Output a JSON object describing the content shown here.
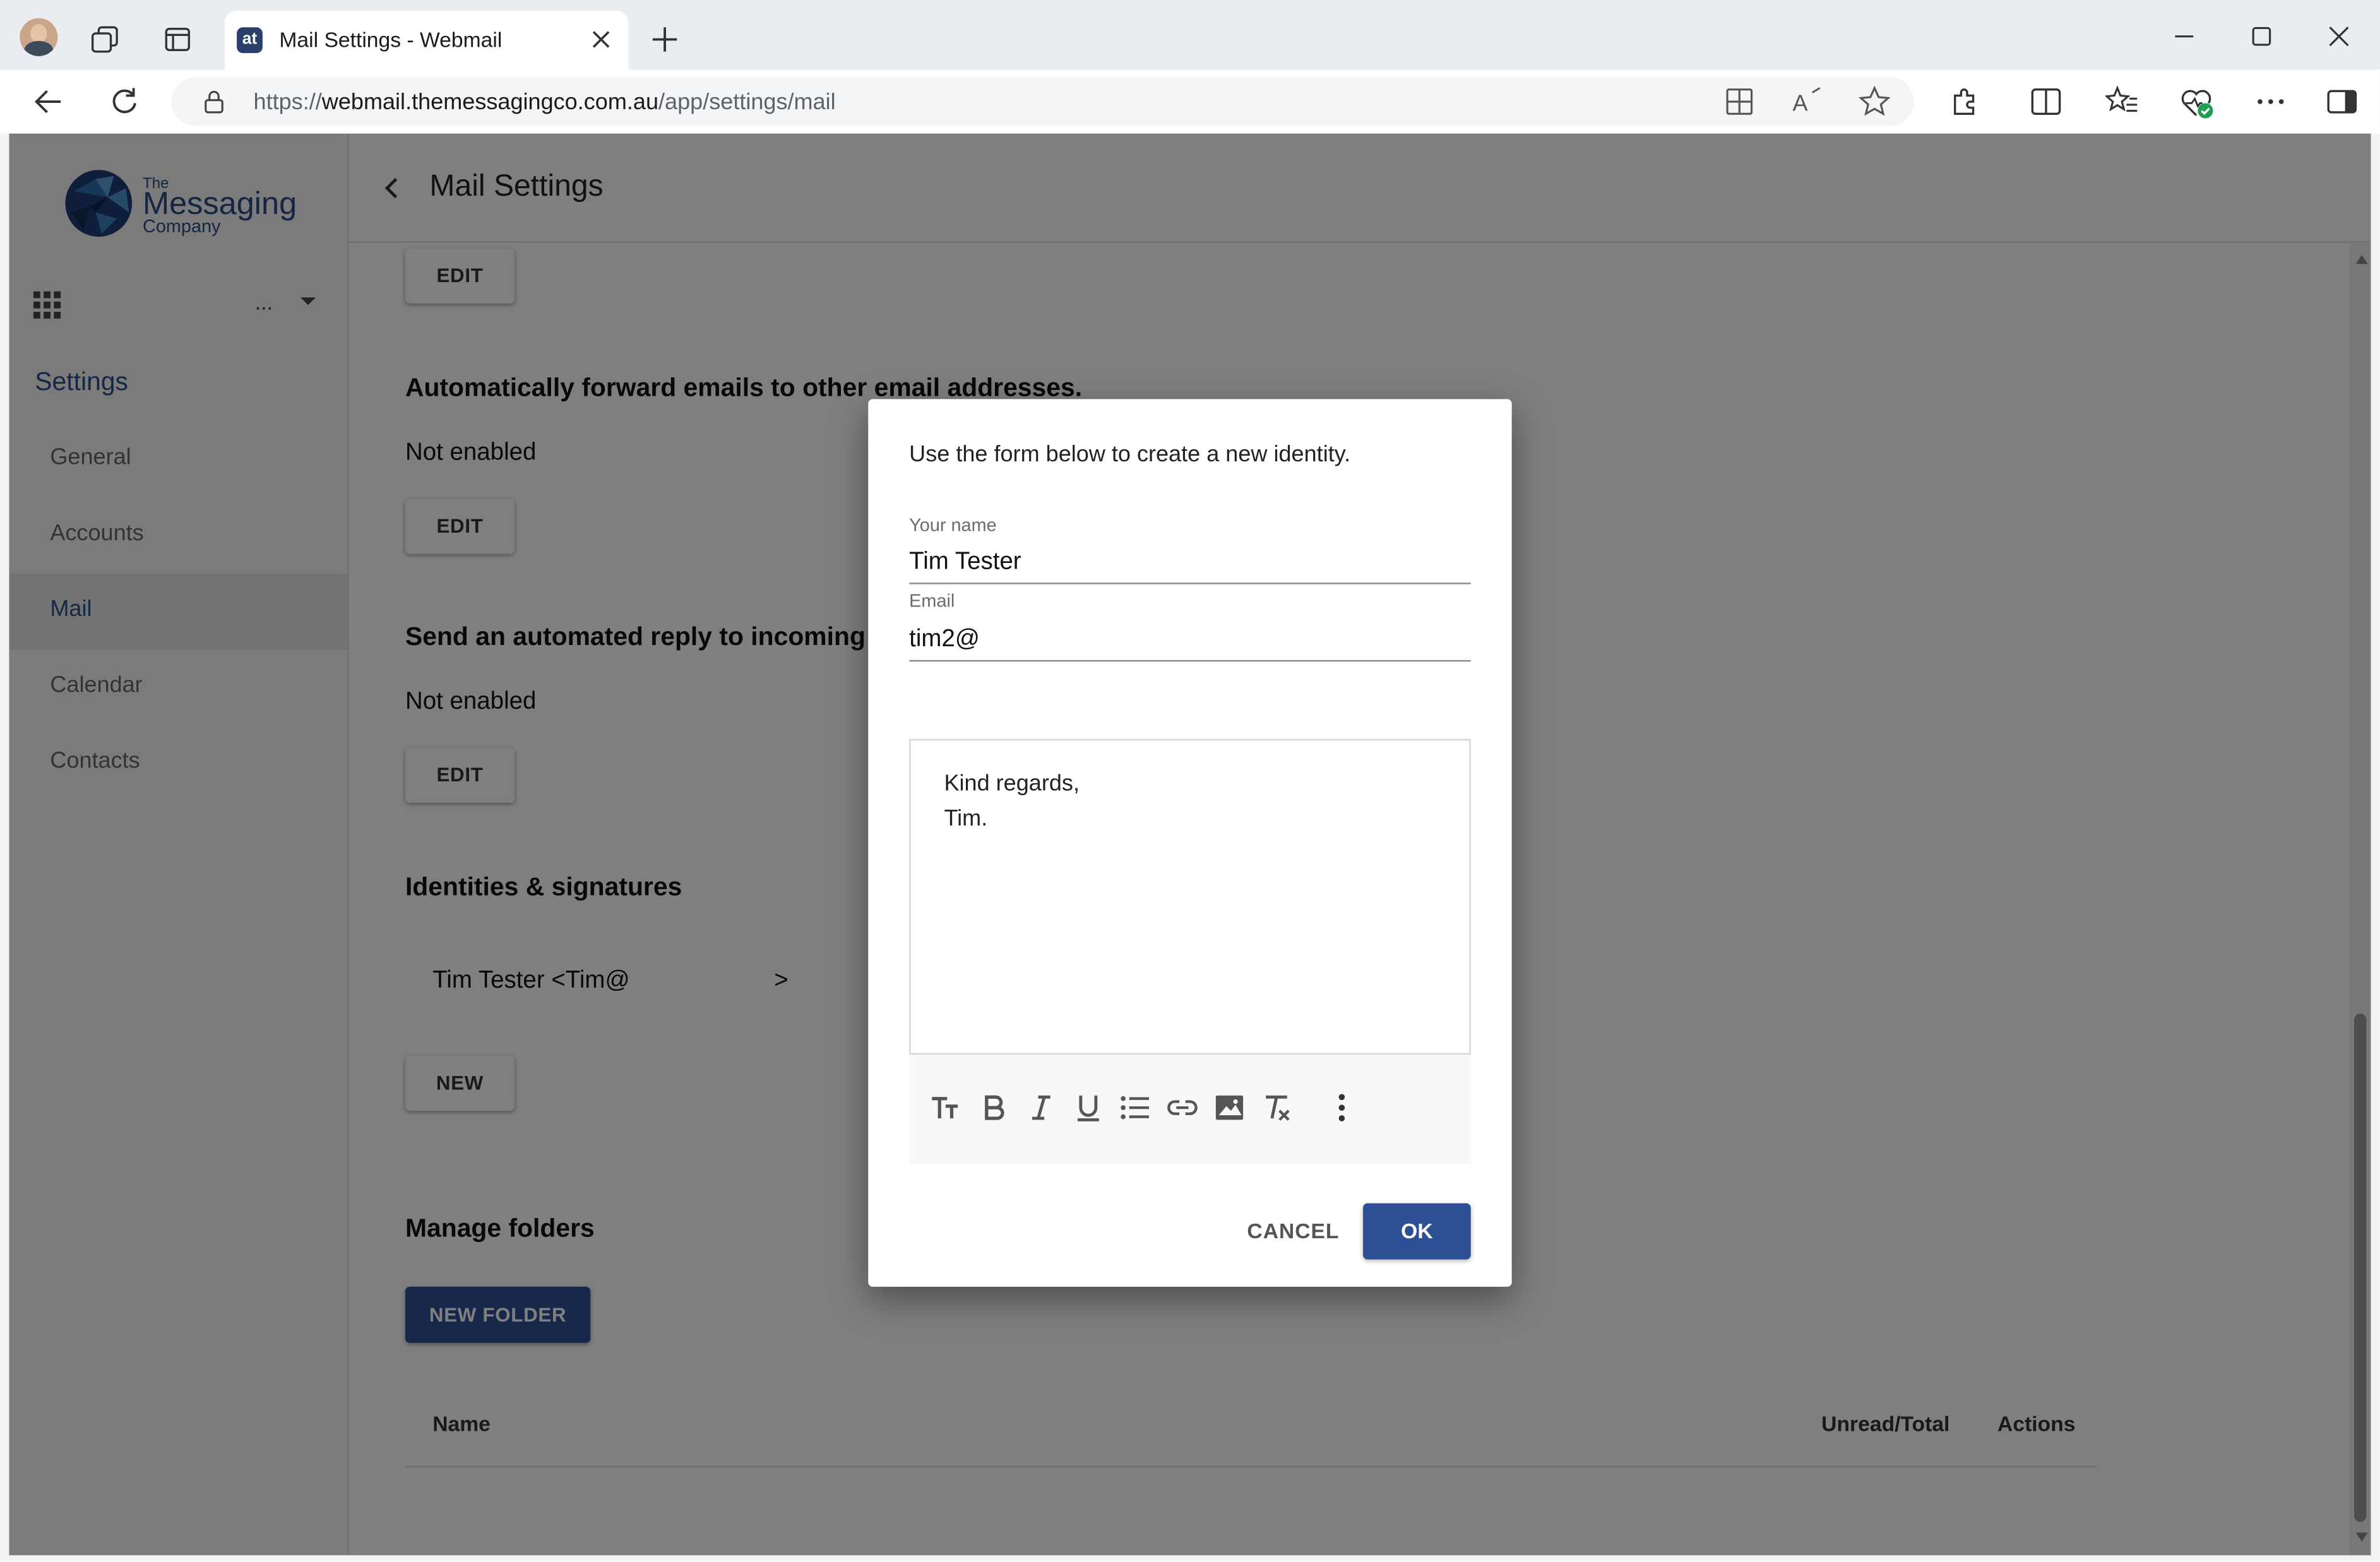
{
  "browser": {
    "tab_title": "Mail Settings - Webmail",
    "tab_favicon": "at",
    "url_scheme": "https://",
    "url_host": "webmail.themessagingco.com.au",
    "url_path": "/app/settings/mail"
  },
  "sidebar": {
    "logo_line1": "The",
    "logo_line2": "Messaging",
    "logo_line3": "Company",
    "account_menu": "...",
    "section_title": "Settings",
    "items": [
      {
        "label": "General"
      },
      {
        "label": "Accounts"
      },
      {
        "label": "Mail"
      },
      {
        "label": "Calendar"
      },
      {
        "label": "Contacts"
      }
    ]
  },
  "header": {
    "title": "Mail Settings"
  },
  "main": {
    "edit_label": "EDIT",
    "forward": {
      "title": "Automatically forward emails to other email addresses.",
      "status": "Not enabled"
    },
    "autoreply": {
      "title": "Send an automated reply to incoming",
      "status": "Not enabled"
    },
    "identities": {
      "title": "Identities & signatures",
      "entry": "Tim Tester <Tim@",
      "entry_end": ">",
      "new_label": "NEW"
    },
    "folders": {
      "title": "Manage folders",
      "new_folder_label": "NEW FOLDER",
      "columns": [
        "Name",
        "Unread/Total",
        "Actions"
      ]
    }
  },
  "dialog": {
    "intro": "Use the form below to create a new identity.",
    "name_label": "Your name",
    "name_value": "Tim Tester",
    "email_label": "Email",
    "email_value": "tim2@",
    "signature_lines": [
      "Kind regards,",
      "Tim."
    ],
    "cancel_label": "CANCEL",
    "ok_label": "OK"
  },
  "colors": {
    "accent": "#2d4f93",
    "sidebar_active_text": "#2d4d8a",
    "overlay": "rgba(0,0,0,0.5)"
  }
}
